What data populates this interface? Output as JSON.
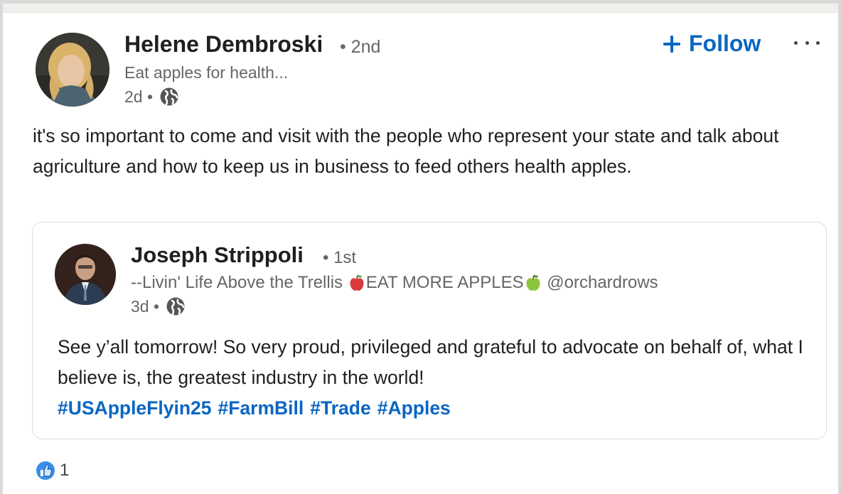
{
  "post": {
    "author": {
      "name": "Helene Dembroski",
      "degree": "• 2nd",
      "headline": "Eat apples for health...",
      "time": "2d •",
      "avatar_icon": "profile-photo-woman-icon"
    },
    "follow_label": "Follow",
    "text": "it's so important to come and visit with the people who represent your state and talk about agriculture and how to keep us in business to feed others health apples."
  },
  "shared_post": {
    "author": {
      "name": "Joseph Strippoli",
      "degree": "• 1st",
      "headline_part1": "--Livin' Life Above the Trellis ",
      "headline_part2": "EAT MORE APPLES",
      "headline_part3": " @orchardrows",
      "time": "3d •",
      "avatar_icon": "profile-photo-man-icon"
    },
    "text": "See y’all tomorrow! So very proud, privileged and grateful to advocate on behalf of, what I believe is, the greatest industry in the world!",
    "hashtags": [
      "#USAppleFlyin25",
      "#FarmBill",
      "#Trade",
      "#Apples"
    ]
  },
  "reactions": {
    "count": "1",
    "icon": "like-icon"
  },
  "colors": {
    "link": "#0a66c2",
    "text": "#1f1f1f",
    "muted": "#666666"
  }
}
